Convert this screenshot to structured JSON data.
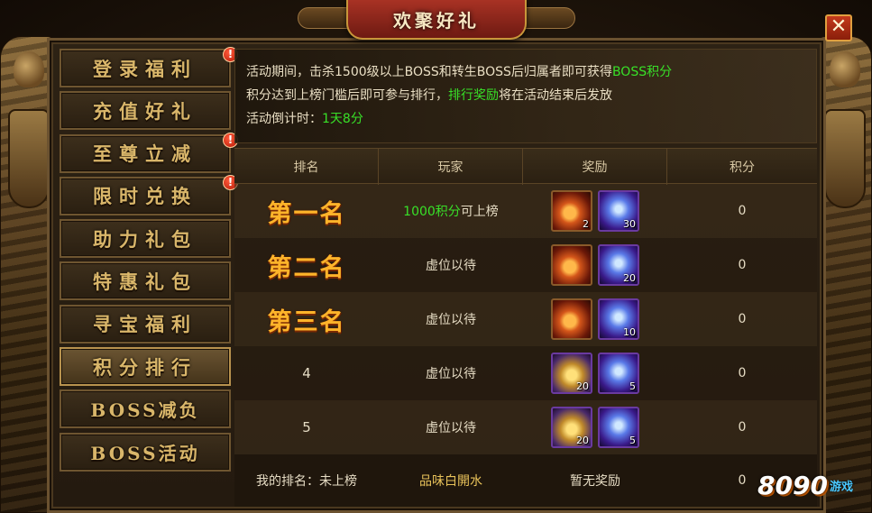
{
  "header": {
    "title": "欢聚好礼"
  },
  "close_label": "✕",
  "menu": {
    "items": [
      {
        "label": "登录福利",
        "alert": true,
        "active": false
      },
      {
        "label": "充值好礼",
        "alert": false,
        "active": false
      },
      {
        "label": "至尊立减",
        "alert": true,
        "active": false
      },
      {
        "label": "限时兑换",
        "alert": true,
        "active": false
      },
      {
        "label": "助力礼包",
        "alert": false,
        "active": false
      },
      {
        "label": "特惠礼包",
        "alert": false,
        "active": false
      },
      {
        "label": "寻宝福利",
        "alert": false,
        "active": false
      },
      {
        "label": "积分排行",
        "alert": false,
        "active": true
      },
      {
        "label": "BOSS减负",
        "alert": false,
        "active": false
      },
      {
        "label": "BOSS活动",
        "alert": false,
        "active": false
      }
    ],
    "alert_glyph": "!"
  },
  "info": {
    "line1_prefix": "活动期间，击杀1500级以上BOSS和转生BOSS后归属者即可获得",
    "line1_highlight": "BOSS积分",
    "line2_prefix": "积分达到上榜门槛后即可参与排行，",
    "line2_highlight": "排行奖励",
    "line2_suffix": "将在活动结束后发放",
    "line3_prefix": "活动倒计时：",
    "line3_highlight": "1天8分"
  },
  "table": {
    "headers": [
      "排名",
      "玩家",
      "奖励",
      "积分"
    ],
    "rows": [
      {
        "rank": "第一名",
        "player_hl": "1000积分",
        "player": "可上榜",
        "rewards": [
          {
            "type": "potion",
            "count": "2"
          },
          {
            "type": "crystal",
            "count": "30"
          }
        ],
        "score": "0"
      },
      {
        "rank": "第二名",
        "player_hl": "",
        "player": "虚位以待",
        "rewards": [
          {
            "type": "potion",
            "count": ""
          },
          {
            "type": "crystal",
            "count": "20"
          }
        ],
        "score": "0"
      },
      {
        "rank": "第三名",
        "player_hl": "",
        "player": "虚位以待",
        "rewards": [
          {
            "type": "potion",
            "count": ""
          },
          {
            "type": "crystal",
            "count": "10"
          }
        ],
        "score": "0"
      },
      {
        "rank": "4",
        "player_hl": "",
        "player": "虚位以待",
        "rewards": [
          {
            "type": "chest",
            "count": "20"
          },
          {
            "type": "crystal",
            "count": "5"
          }
        ],
        "score": "0"
      },
      {
        "rank": "5",
        "player_hl": "",
        "player": "虚位以待",
        "rewards": [
          {
            "type": "chest",
            "count": "20"
          },
          {
            "type": "crystal",
            "count": "5"
          }
        ],
        "score": "0"
      }
    ]
  },
  "my_rank": {
    "label": "我的排名：未上榜",
    "player": "品味白開水",
    "reward": "暂无奖励",
    "score": "0"
  },
  "logo": {
    "number": "8090",
    "text": "游戏"
  },
  "colors": {
    "highlight_green": "#38e028",
    "rank_gold": "#ffb42a",
    "header_red": "#a83224"
  }
}
